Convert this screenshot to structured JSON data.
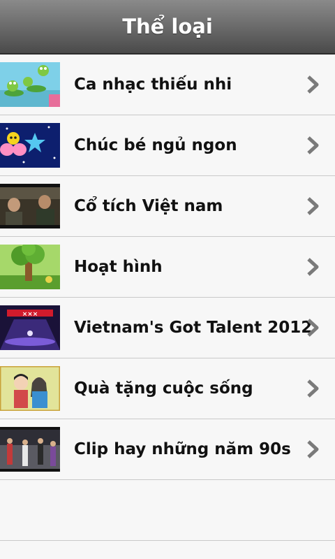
{
  "header": {
    "title": "Thể loại"
  },
  "categories": [
    {
      "label": "Ca nhạc thiếu nhi",
      "thumb": "cartoon-frogs-thumbnail"
    },
    {
      "label": "Chúc bé ngủ ngon",
      "thumb": "starry-night-bee-thumbnail"
    },
    {
      "label": "Cổ tích Việt nam",
      "thumb": "film-scene-thumbnail"
    },
    {
      "label": "Hoạt hình",
      "thumb": "cartoon-tree-thumbnail"
    },
    {
      "label": "Vietnam's Got Talent 2012",
      "thumb": "talent-show-stage-thumbnail"
    },
    {
      "label": "Quà tặng cuộc sống",
      "thumb": "illustrated-couple-thumbnail"
    },
    {
      "label": "Clip hay những năm 90s",
      "thumb": "street-dance-thumbnail"
    }
  ],
  "colors": {
    "header_top": "#8a8a8a",
    "header_bottom": "#4a4a4a",
    "chevron": "#7a7a7a",
    "background": "#f7f7f7"
  }
}
